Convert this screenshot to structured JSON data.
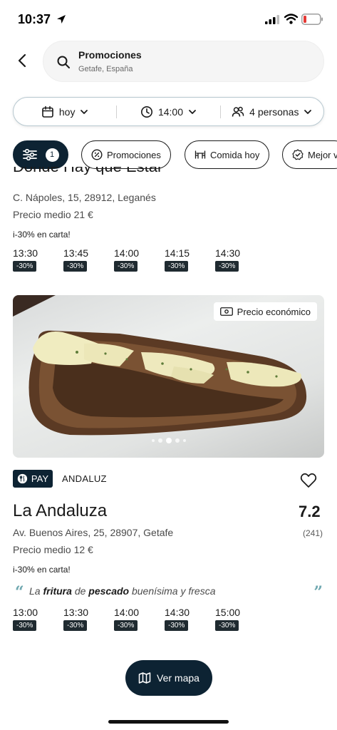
{
  "status_bar": {
    "time": "10:37",
    "icons": [
      "location-arrow-icon",
      "signal-icon",
      "wifi-icon",
      "battery-icon"
    ],
    "battery_color": "#e53935"
  },
  "search": {
    "title": "Promociones",
    "subtitle": "Getafe, España"
  },
  "booking": {
    "date": "hoy",
    "time": "14:00",
    "people": "4 personas"
  },
  "filters": {
    "count": "1",
    "chips": [
      "Promociones",
      "Comida hoy",
      "Mejor v"
    ]
  },
  "restaurants": [
    {
      "name": "Donde Hay que Estar",
      "address": "C. Nápoles, 15, 28912, Leganés",
      "price": "Precio medio 21 €",
      "promo": "i-30% en carta!",
      "slots": [
        {
          "time": "13:30",
          "discount": "-30%"
        },
        {
          "time": "13:45",
          "discount": "-30%"
        },
        {
          "time": "14:00",
          "discount": "-30%"
        },
        {
          "time": "14:15",
          "discount": "-30%"
        },
        {
          "time": "14:30",
          "discount": "-30%"
        }
      ]
    },
    {
      "photo_tag": "Precio económico",
      "photo_dot_count": 5,
      "photo_dot_active": 3,
      "pay_label": "PAY",
      "cuisine": "ANDALUZ",
      "name": "La Andaluza",
      "rating": "7.2",
      "reviews": "(241)",
      "address": "Av. Buenos Aires, 25, 28907, Getafe",
      "price": "Precio medio 12 €",
      "promo": "i-30% en carta!",
      "review": {
        "w1": "La",
        "w2": "fritura",
        "w3": "de",
        "w4": "pescado",
        "w5": "buenísima y fresca"
      },
      "slots": [
        {
          "time": "13:00",
          "discount": "-30%"
        },
        {
          "time": "13:30",
          "discount": "-30%"
        },
        {
          "time": "14:00",
          "discount": "-30%"
        },
        {
          "time": "14:30",
          "discount": "-30%"
        },
        {
          "time": "15:00",
          "discount": "-30%"
        }
      ]
    }
  ],
  "map_button": "Ver mapa",
  "colors": {
    "primary": "#0d2333",
    "accent": "#6fa8b0",
    "badge": "#1f2a30"
  }
}
